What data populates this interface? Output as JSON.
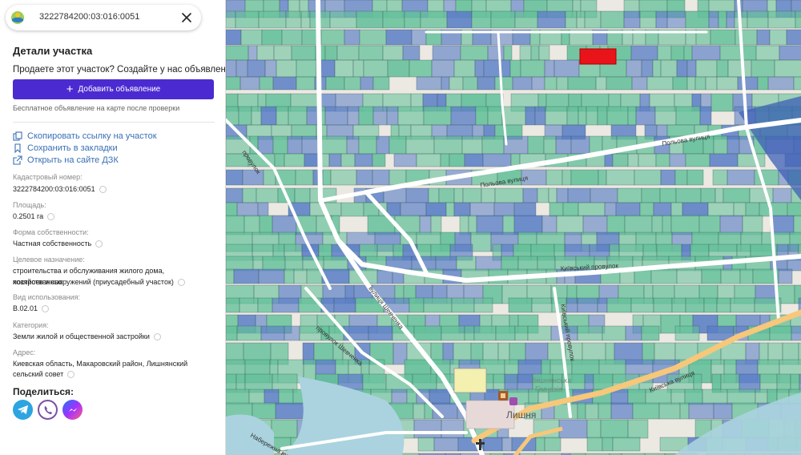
{
  "search": {
    "value": "3222784200:03:016:0051"
  },
  "panel": {
    "title": "Детали участка",
    "promo": "Продаете этот участок? Создайте у нас объявления!",
    "add_button": "Добавить объявление",
    "free_note": "Бесплатное объявление на карте после проверки"
  },
  "links": {
    "copy": "Скопировать ссылку на участок",
    "bookmark": "Сохранить в закладки",
    "open": "Открыть на сайте ДЗК"
  },
  "fields": {
    "cadastral_label": "Кадастровый номер:",
    "cadastral_value": "3222784200:03:016:0051",
    "area_label": "Площадь:",
    "area_value": "0.2501 га",
    "ownership_label": "Форма собственности:",
    "ownership_value": "Частная собственность",
    "purpose_label": "Целевое назначение:",
    "purpose_line1": "строительства и обслуживания жилого дома, хозяйственных",
    "purpose_line2": "построек и сооружений (приусадебный участок)",
    "usage_label": "Вид использования:",
    "usage_value": "В.02.01",
    "category_label": "Категория:",
    "category_value": "Земли жилой и общественной застройки",
    "address_label": "Адрес:",
    "address_line1": "Киевская область, Макаровский район, Лишнянский",
    "address_line2": "сельский совет"
  },
  "share": {
    "title": "Поделиться:",
    "buttons": [
      "telegram-icon",
      "viber-icon",
      "messenger-icon"
    ]
  },
  "map": {
    "labels": {
      "polova1": "Польова вулиця",
      "polova2": "Польова вулиця",
      "kyivskyi_provulok": "Київський провулок",
      "shevchenka_street": "вулиця Шевченка",
      "shevchenka_lane": "провулок Шевченка",
      "kyivska_street": "Київська вулиця",
      "gymnasium1": "Лишнянська",
      "gymnasium2": "Гімназія",
      "village": "Лишня",
      "naberezhna": "Набережна вулиця",
      "provulok_left": "провулок",
      "kyivskyi_vertical": "Київський провулок"
    },
    "colors": {
      "parcel_green": "#63c09a",
      "parcel_blue": "#5b7fc6",
      "selected": "#e8141a",
      "water": "#aad3df",
      "road": "#ffffff",
      "main_road": "#f7c77a"
    }
  }
}
